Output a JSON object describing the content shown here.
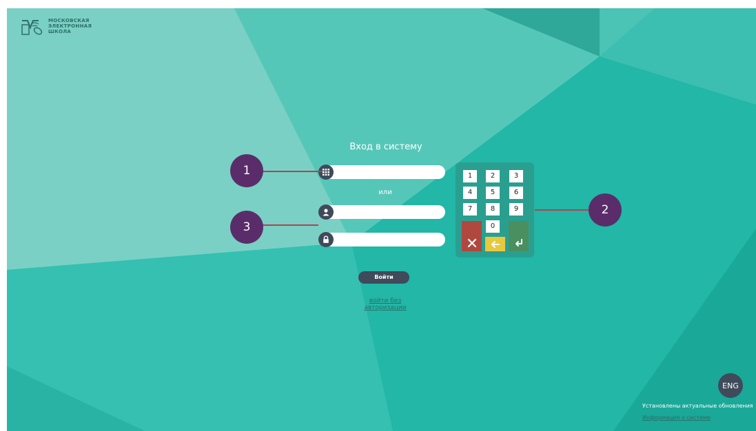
{
  "logo": {
    "line1": "МОСКОВСКАЯ",
    "line2": "ЭЛЕКТРОННАЯ",
    "line3": "ШКОЛА"
  },
  "login": {
    "title": "Вход в систему",
    "or_text": "или",
    "pin_field": {
      "value": "",
      "placeholder": ""
    },
    "login_field": {
      "value": "",
      "placeholder": ""
    },
    "password_field": {
      "value": "",
      "placeholder": ""
    },
    "submit_label": "Войти",
    "guest_link": "войти без авторизации"
  },
  "keypad": {
    "keys": [
      "1",
      "2",
      "3",
      "4",
      "5",
      "6",
      "7",
      "8",
      "9",
      "0"
    ],
    "clear_icon": "close-icon",
    "backspace_icon": "arrow-left-icon",
    "enter_icon": "enter-icon"
  },
  "callouts": {
    "one": "1",
    "two": "2",
    "three": "3"
  },
  "footer": {
    "lang_button": "ENG",
    "updates_text": "Установлены актуальные обновления",
    "system_info_link": "Информация о системе"
  },
  "colors": {
    "background": "#2fbfaf",
    "dark": "#3f4a5a",
    "marker": "#5a2d6a",
    "callout_line": "#b44050",
    "keypad": "#2a9f90",
    "clear_key": "#b0483f",
    "backspace_key": "#e7c93f",
    "enter_key": "#4a8f5f"
  }
}
